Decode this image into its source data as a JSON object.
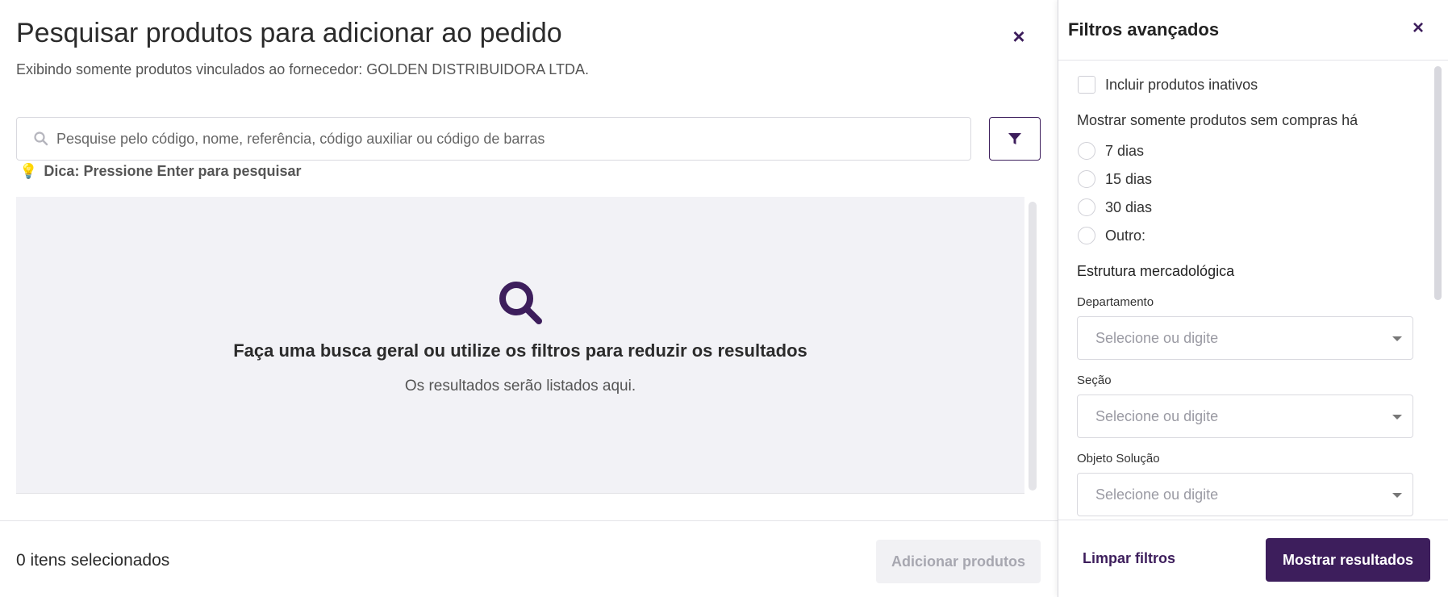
{
  "modal": {
    "title": "Pesquisar produtos para adicionar ao pedido",
    "close_icon": "×",
    "subtitle": "Exibindo somente produtos vinculados ao fornecedor: GOLDEN DISTRIBUIDORA LTDA.",
    "search": {
      "placeholder": "Pesquise pelo código, nome, referência, código auxiliar ou código de barras",
      "value": ""
    },
    "tip": "Dica: Pressione Enter para pesquisar",
    "empty_state": {
      "title": "Faça uma busca geral ou utilize os filtros para reduzir os resultados",
      "subtitle": "Os resultados serão listados aqui."
    },
    "footer": {
      "selected_count": "0 itens selecionados",
      "add_label": "Adicionar produtos"
    }
  },
  "panel": {
    "title": "Filtros avançados",
    "close_icon": "×",
    "include_inactive": "Incluir produtos inativos",
    "no_purchase_label": "Mostrar somente produtos sem compras há",
    "radio_options": [
      "7 dias",
      "15 dias",
      "30 dias",
      "Outro:"
    ],
    "structure_label": "Estrutura mercadológica",
    "fields": [
      {
        "label": "Departamento",
        "placeholder": "Selecione ou digite"
      },
      {
        "label": "Seção",
        "placeholder": "Selecione ou digite"
      },
      {
        "label": "Objeto Solução",
        "placeholder": "Selecione ou digite"
      }
    ],
    "clear_label": "Limpar filtros",
    "show_label": "Mostrar resultados"
  },
  "colors": {
    "accent": "#3d1e5c",
    "tip_icon": "#f3b43c",
    "empty_bg": "#f2f2f6"
  },
  "icons": {
    "search": "search-icon",
    "filter": "filter-icon",
    "tip": "lightbulb-icon",
    "empty": "magnifier-icon"
  }
}
